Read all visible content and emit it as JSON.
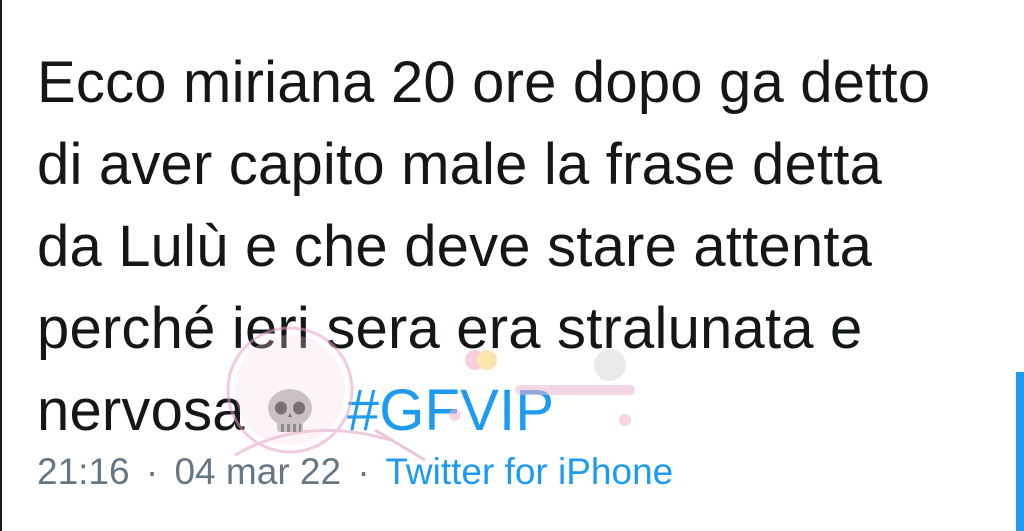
{
  "tweet": {
    "text_lines": [
      "Ecco miriana 20 ore dopo ga detto",
      "di aver capito male la frase detta",
      "da Lulù e che deve stare attenta",
      "perché ieri sera era stralunata e",
      "nervosa"
    ],
    "emoji": "skull-emoji",
    "hashtag": "#GFVIP",
    "time": "21:16",
    "separator": "·",
    "date": "04 mar 22",
    "source": "Twitter for iPhone"
  },
  "colors": {
    "text": "#14171a",
    "link": "#1d9bf0",
    "meta": "#657786",
    "background": "#ffffff"
  }
}
